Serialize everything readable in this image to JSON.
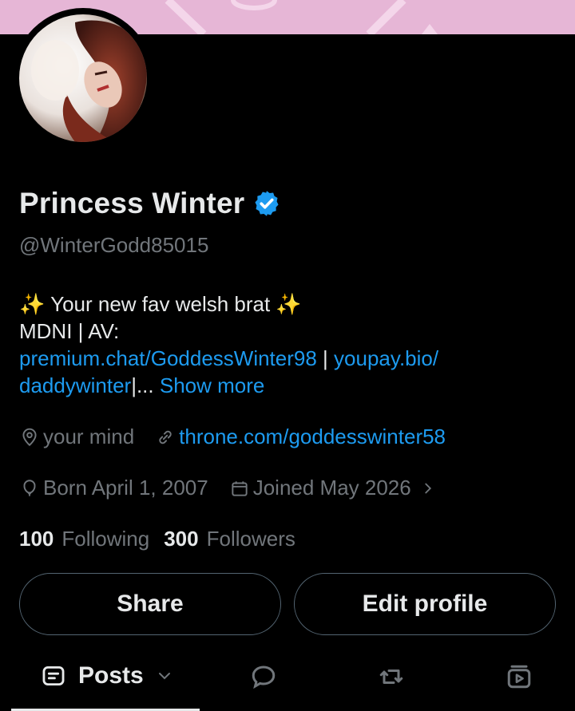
{
  "profile": {
    "display_name": "Princess Winter",
    "handle": "@WinterGodd85015",
    "bio": {
      "line1": "✨ Your new fav welsh brat ✨",
      "line2": "MDNI | AV:",
      "link1": "premium.chat/GoddessWinter98",
      "separator": " | ",
      "link2": "youpay.bio/",
      "link2_cont": "daddywinter",
      "ellipsis": "|... ",
      "show_more": "Show more"
    },
    "location": "your mind",
    "website": "throne.com/goddesswinter58",
    "birthday": "Born April 1, 2007",
    "joined": "Joined May 2026",
    "following_count": "100",
    "following_label": "Following",
    "followers_count": "300",
    "followers_label": "Followers"
  },
  "actions": {
    "share_label": "Share",
    "edit_label": "Edit profile"
  },
  "tabs": {
    "posts_label": "Posts"
  },
  "icons": {
    "verified": "verified-badge-icon",
    "location": "location-pin-icon",
    "link": "link-icon",
    "birthday": "balloon-icon",
    "calendar": "calendar-icon",
    "chevron": "chevron-right-icon",
    "tab_posts": "posts-icon",
    "tab_replies": "reply-icon",
    "tab_retweets": "retweet-icon",
    "tab_media": "media-icon"
  },
  "colors": {
    "link": "#1d9bf0",
    "verified": "#1d9bf0",
    "banner": "#e6b6d6"
  }
}
